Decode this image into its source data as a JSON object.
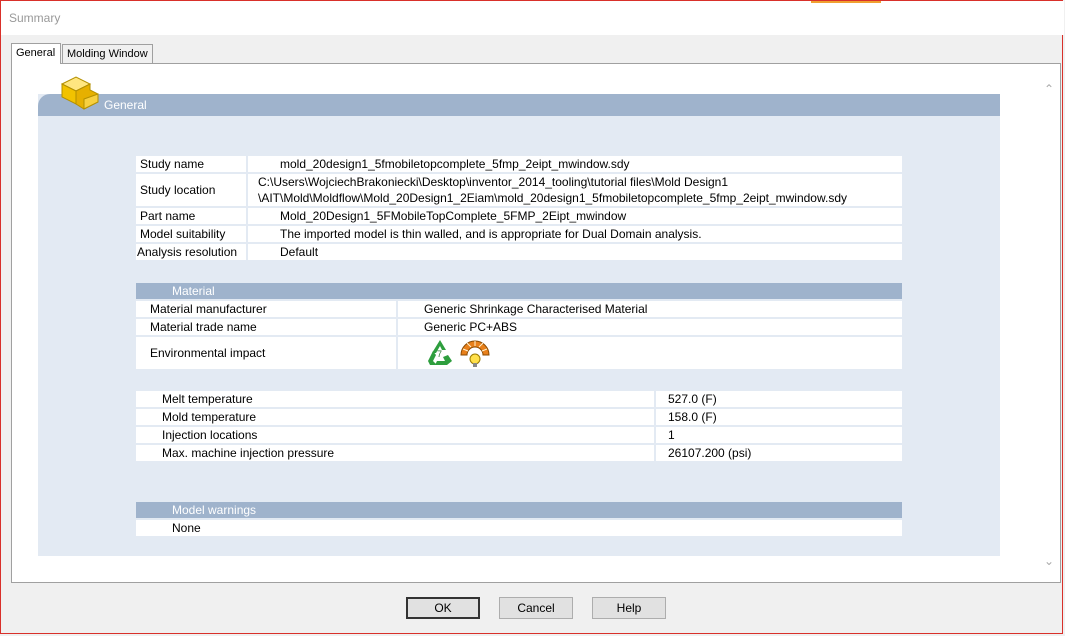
{
  "window": {
    "title": "Summary"
  },
  "tabs": [
    {
      "label": "General"
    },
    {
      "label": "Molding Window"
    }
  ],
  "general": {
    "header": "General"
  },
  "study": {
    "rows": [
      {
        "label": "Study name",
        "value": "mold_20design1_5fmobiletopcomplete_5fmp_2eipt_mwindow.sdy"
      },
      {
        "label": "Study location",
        "value_line1": "C:\\Users\\WojciechBrakoniecki\\Desktop\\inventor_2014_tooling\\tutorial files\\Mold Design1",
        "value_line2": "\\AIT\\Mold\\Moldflow\\Mold_20Design1_2Eiam\\mold_20design1_5fmobiletopcomplete_5fmp_2eipt_mwindow.sdy"
      },
      {
        "label": "Part name",
        "value": "Mold_20Design1_5FMobileTopComplete_5FMP_2Eipt_mwindow"
      },
      {
        "label": "Model suitability",
        "value": "The imported model is thin walled, and is appropriate for Dual Domain analysis."
      },
      {
        "label": "Analysis resolution",
        "value": "Default"
      }
    ]
  },
  "material": {
    "header": "Material",
    "rows": [
      {
        "label": "Material manufacturer",
        "value": "Generic Shrinkage Characterised Material"
      },
      {
        "label": "Material trade name",
        "value": "Generic PC+ABS"
      },
      {
        "label": "Environmental impact",
        "icons": [
          "recycle-7-icon",
          "energy-gauge-icon"
        ]
      }
    ]
  },
  "process": {
    "rows": [
      {
        "label": "Melt temperature",
        "value": "527.0 (F)"
      },
      {
        "label": "Mold temperature",
        "value": "158.0 (F)"
      },
      {
        "label": "Injection locations",
        "value": "1"
      },
      {
        "label": "Max. machine injection pressure",
        "value": "26107.200 (psi)"
      }
    ]
  },
  "warnings": {
    "header": "Model warnings",
    "value": "None"
  },
  "buttons": {
    "ok": "OK",
    "cancel": "Cancel",
    "help": "Help"
  },
  "colors": {
    "accent": "#9fb3cc",
    "panel_bg": "#e3eaf3",
    "border": "#d9302a"
  }
}
